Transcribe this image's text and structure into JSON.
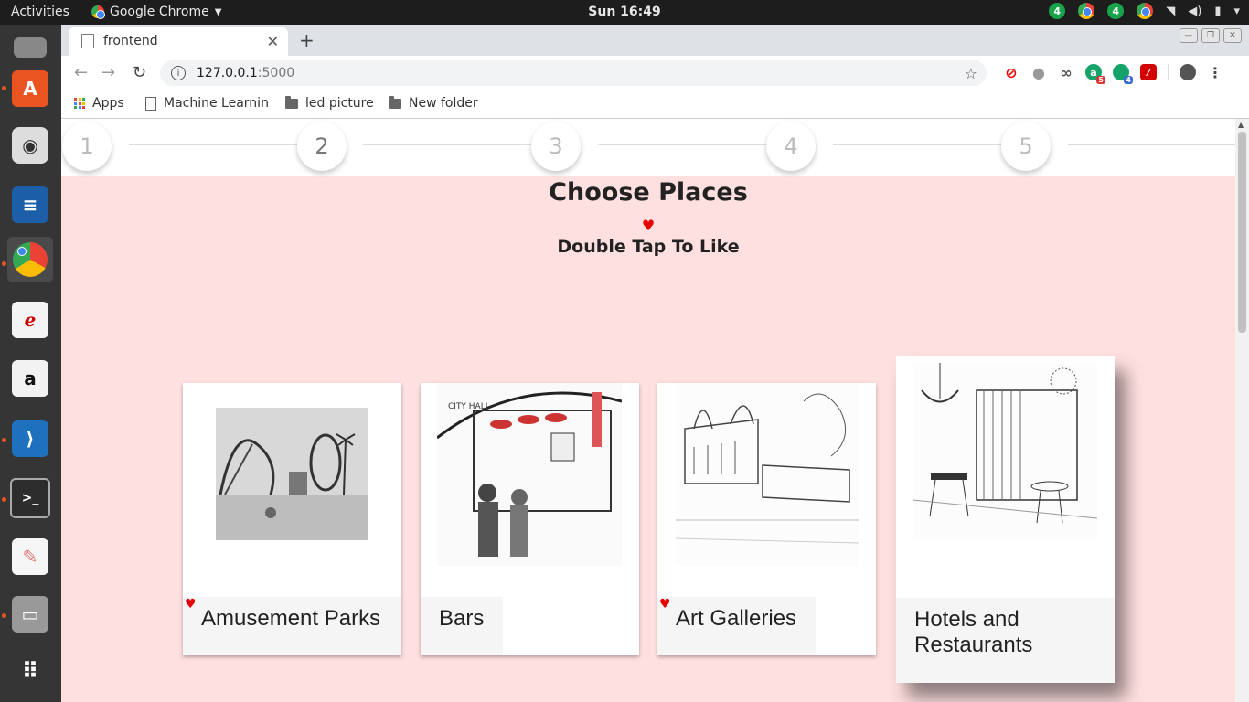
{
  "topbar": {
    "activities": "Activities",
    "app_name": "Google Chrome",
    "clock": "Sun 16:49",
    "badges": [
      "4",
      "4"
    ]
  },
  "browser": {
    "tab_title": "frontend",
    "url_host": "127.0.0.1",
    "url_port": ":5000",
    "bookmarks": {
      "apps": "Apps",
      "item1": "Machine Learnin",
      "item2": "led picture",
      "item3": "New folder"
    },
    "ext_badges": [
      "5",
      "4"
    ]
  },
  "stepper": {
    "steps": [
      "1",
      "2",
      "3",
      "4",
      "5"
    ],
    "current": 2
  },
  "page": {
    "title": "Choose Places",
    "subtitle": "Double Tap To Like",
    "heart": "♥",
    "accent": "#e60000",
    "background": "#ffe0e1"
  },
  "cards": [
    {
      "label": "Amusement Parks",
      "liked": true
    },
    {
      "label": "Bars",
      "liked": false
    },
    {
      "label": "Art Galleries",
      "liked": true
    },
    {
      "label": "Hotels and Restaurants",
      "liked": false
    }
  ]
}
